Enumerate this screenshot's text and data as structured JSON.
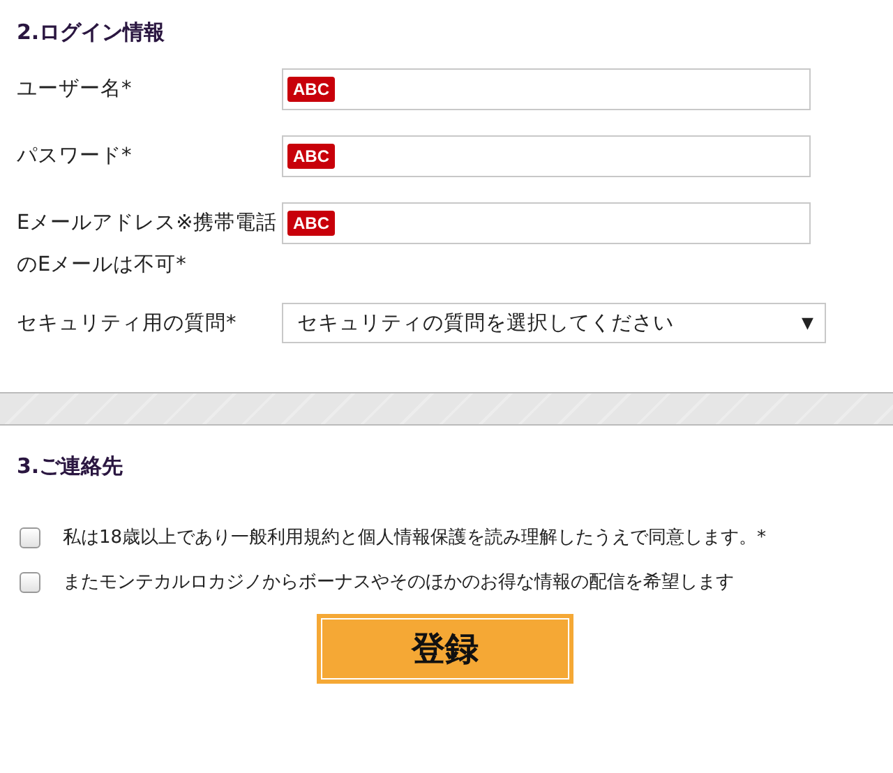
{
  "login": {
    "heading": "2.ログイン情報",
    "fields": [
      {
        "label": "ユーザー名*",
        "badge": "ABC"
      },
      {
        "label": "パスワード*",
        "badge": "ABC"
      },
      {
        "label": "Eメールアドレス※携帯電話のEメールは不可*",
        "badge": "ABC"
      }
    ],
    "security": {
      "label": "セキュリティ用の質問*",
      "value": "セキュリティの質問を選択してください",
      "arrow": "▼"
    }
  },
  "contact": {
    "heading": "3.ご連絡先",
    "checkboxes": [
      {
        "label": "私は18歳以上であり一般利用規約と個人情報保護を読み理解したうえで同意します。*",
        "checked": false
      },
      {
        "label": "またモンテカルロカジノからボーナスやそのほかのお得な情報の配信を希望します",
        "checked": false
      }
    ],
    "submit": "登録"
  }
}
